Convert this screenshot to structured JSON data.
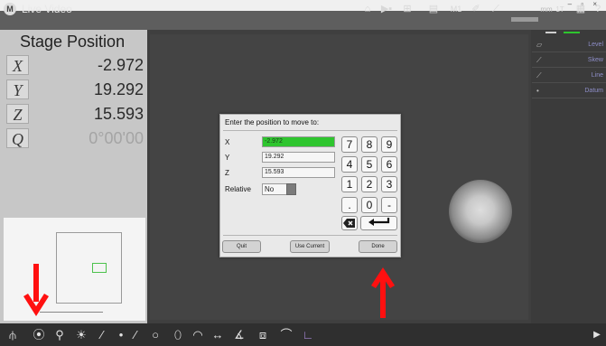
{
  "window": {
    "controls": "– ▫ ×"
  },
  "titlebar": {
    "app_title": "Live Video",
    "logo_text": "M",
    "m1_label": "M1",
    "mm_label": "mm",
    "one_t_label": "1T",
    "help_label": "?"
  },
  "stage": {
    "title": "Stage Position",
    "axes": [
      {
        "label": "X",
        "value": "-2.972"
      },
      {
        "label": "Y",
        "value": "19.292"
      },
      {
        "label": "Z",
        "value": "15.593"
      },
      {
        "label": "Q",
        "value": "0°00'00"
      }
    ]
  },
  "right_panel": {
    "items": [
      "Level",
      "Skew",
      "Line",
      "Datum"
    ]
  },
  "dialog": {
    "prompt": "Enter the position to move to:",
    "fields": [
      {
        "label": "X",
        "value": "-2.972"
      },
      {
        "label": "Y",
        "value": "19.292"
      },
      {
        "label": "Z",
        "value": "15.593"
      }
    ],
    "relative_label": "Relative",
    "relative_value": "No",
    "keypad": [
      "7",
      "8",
      "9",
      "4",
      "5",
      "6",
      "1",
      "2",
      "3",
      ".",
      "0",
      "-"
    ],
    "buttons": {
      "quit": "Quit",
      "use_current": "Use Current",
      "done": "Done"
    }
  },
  "annotations": {
    "arrow_color": "#ff1010"
  },
  "colors": {
    "highlight_field": "#2ec52e",
    "target_box": "#4cc24c"
  }
}
